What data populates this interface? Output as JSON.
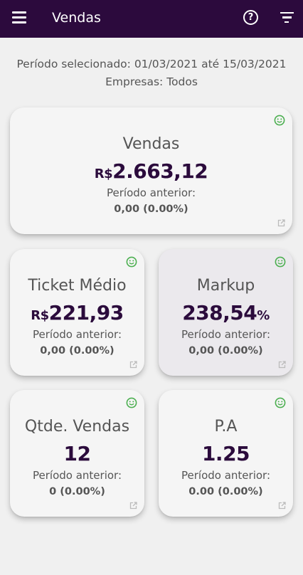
{
  "header": {
    "title": "Vendas",
    "menu_icon": "menu-icon",
    "help_icon": "help-icon",
    "filter_icon": "filter-icon"
  },
  "filters": {
    "period": "Período selecionado: 01/03/2021 até 15/03/2021",
    "companies": "Empresas: Todos"
  },
  "colors": {
    "appbar": "#2c0a3d",
    "value_text": "#2b0b3c",
    "smile_icon": "#4caf50"
  },
  "cards": {
    "vendas": {
      "title": "Vendas",
      "currency": "R$",
      "value": "2.663,12",
      "prev_label": "Período anterior:",
      "prev_value": "0,00 (0.00%)",
      "status_icon": "smile-icon",
      "link_icon": "open-external-icon"
    },
    "ticket": {
      "title": "Ticket Médio",
      "currency": "R$",
      "value": "221,93",
      "prev_label": "Período anterior:",
      "prev_value": "0,00 (0.00%)"
    },
    "markup": {
      "title": "Markup",
      "value": "238,54",
      "suffix": "%",
      "prev_label": "Período anterior:",
      "prev_value": "0,00 (0.00%)"
    },
    "qtde": {
      "title": "Qtde. Vendas",
      "value": "12",
      "prev_label": "Período anterior:",
      "prev_value": "0 (0.00%)"
    },
    "pa": {
      "title": "P.A",
      "value": "1.25",
      "prev_label": "Período anterior:",
      "prev_value": "0.00 (0.00%)"
    }
  }
}
